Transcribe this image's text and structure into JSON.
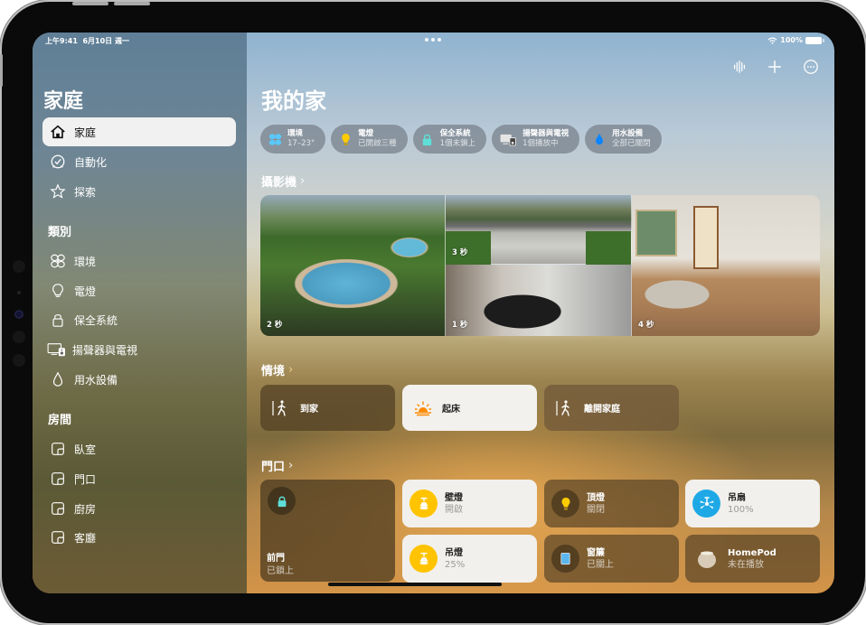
{
  "status_bar": {
    "time": "上午9:41",
    "date": "6月10日 週一",
    "battery": "100%"
  },
  "sidebar": {
    "title": "家庭",
    "nav": [
      {
        "label": "家庭",
        "icon": "house-icon",
        "active": true
      },
      {
        "label": "自動化",
        "icon": "clock-icon"
      },
      {
        "label": "探索",
        "icon": "star-icon"
      }
    ],
    "categories_heading": "類別",
    "categories": [
      {
        "label": "環境",
        "icon": "fan-icon"
      },
      {
        "label": "電燈",
        "icon": "lightbulb-icon"
      },
      {
        "label": "保全系統",
        "icon": "lock-icon"
      },
      {
        "label": "揚聲器與電視",
        "icon": "tv-speaker-icon"
      },
      {
        "label": "用水設備",
        "icon": "water-drop-icon"
      }
    ],
    "rooms_heading": "房間",
    "rooms": [
      {
        "label": "臥室",
        "icon": "room-icon"
      },
      {
        "label": "門口",
        "icon": "room-icon"
      },
      {
        "label": "廚房",
        "icon": "room-icon"
      },
      {
        "label": "客廳",
        "icon": "room-icon"
      }
    ]
  },
  "toolbar": {
    "intercom": "waveform-icon",
    "add": "plus-icon",
    "more": "ellipsis-circle-icon"
  },
  "main": {
    "title": "我的家",
    "chips": [
      {
        "title": "環境",
        "subtitle": "17–23°",
        "icon": "fan-icon",
        "color": "#5ac8fa"
      },
      {
        "title": "電燈",
        "subtitle": "已開啟三種",
        "icon": "lightbulb-icon",
        "color": "#ffcc00"
      },
      {
        "title": "保全系統",
        "subtitle": "1個未鎖上",
        "icon": "lock-icon",
        "color": "#5ee0d8"
      },
      {
        "title": "揚聲器與電視",
        "subtitle": "1個播放中",
        "icon": "tv-speaker-icon",
        "color": "#e5e5e5"
      },
      {
        "title": "用水設備",
        "subtitle": "全部已關閉",
        "icon": "water-drop-icon",
        "color": "#0a84ff"
      }
    ],
    "cameras_heading": "攝影機",
    "cameras": [
      {
        "name": "pool",
        "age": "2 秒"
      },
      {
        "name": "driveway",
        "age": "3 秒"
      },
      {
        "name": "garage",
        "age": "1 秒"
      },
      {
        "name": "living-room",
        "age": "4 秒"
      }
    ],
    "scenes_heading": "情境",
    "scenes": [
      {
        "label": "到家",
        "icon": "person-arrive-icon",
        "active": false
      },
      {
        "label": "起床",
        "icon": "sunrise-icon",
        "active": true
      },
      {
        "label": "離開家庭",
        "icon": "person-leave-icon",
        "active": false
      }
    ],
    "room_heading": "門口",
    "door": {
      "name": "前門",
      "status": "已鎖上"
    },
    "accessories": [
      {
        "name": "壁燈",
        "status": "開啟",
        "icon": "pendant-lamp-icon",
        "on": true
      },
      {
        "name": "頂燈",
        "status": "關閉",
        "icon": "lightbulb-icon",
        "on": false
      },
      {
        "name": "吊扇",
        "status": "100%",
        "icon": "ceiling-fan-icon",
        "on": true
      },
      {
        "name": "吊燈",
        "status": "25%",
        "icon": "pendant-lamp-icon",
        "on": true
      },
      {
        "name": "窗簾",
        "status": "已關上",
        "icon": "blinds-icon",
        "on": false
      },
      {
        "name": "HomePod",
        "status": "未在播放",
        "icon": "homepod-icon",
        "on": false
      }
    ]
  },
  "colors": {
    "accent_yellow": "#ffc300",
    "fan_blue": "#1ea9e6",
    "lock_teal": "#5ee0d8",
    "sunrise_orange": "#ff8a00"
  }
}
